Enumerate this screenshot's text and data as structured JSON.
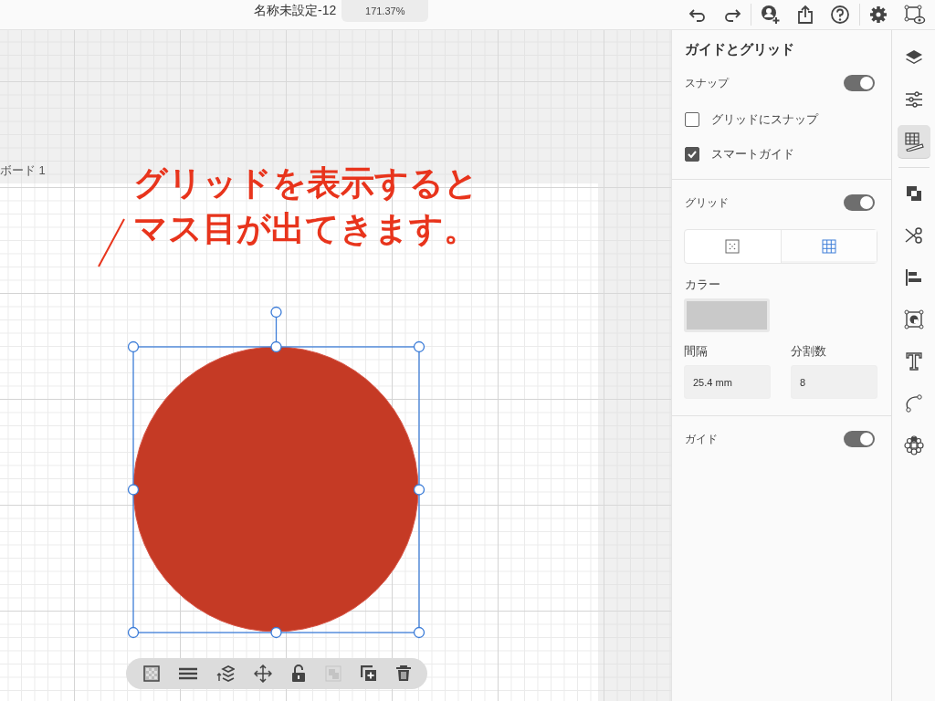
{
  "document": {
    "title": "名称未設定-12",
    "zoom": "171.37%"
  },
  "canvas": {
    "artboard_label": "ボード 1",
    "annotation": [
      "グリッドを表示すると",
      "マス目が出てきます。"
    ],
    "shape": {
      "kind": "circle",
      "selected": true
    }
  },
  "selection_toolbar": [
    {
      "kind": "fill",
      "disabled": false
    },
    {
      "kind": "stroke",
      "disabled": false
    },
    {
      "kind": "arrange",
      "disabled": false
    },
    {
      "kind": "move",
      "disabled": false
    },
    {
      "kind": "lock",
      "disabled": false
    },
    {
      "kind": "group",
      "disabled": true
    },
    {
      "kind": "duplicate",
      "disabled": false
    },
    {
      "kind": "delete",
      "disabled": false
    }
  ],
  "panel": {
    "title": "ガイドとグリッド",
    "snap": {
      "label": "スナップ",
      "on": true,
      "options": [
        {
          "label": "グリッドにスナップ",
          "checked": false
        },
        {
          "label": "スマートガイド",
          "checked": true
        }
      ]
    },
    "grid": {
      "label": "グリッド",
      "on": true,
      "styles": [
        {
          "kind": "dots",
          "selected": false
        },
        {
          "kind": "lines",
          "selected": true
        }
      ],
      "color_label": "カラー",
      "spacing": {
        "label": "間隔",
        "value": "25.4 mm"
      },
      "divisions": {
        "label": "分割数",
        "value": "8"
      }
    },
    "guides": {
      "label": "ガイド",
      "on": true
    }
  },
  "rail": [
    {
      "kind": "layers",
      "selected": false
    },
    {
      "kind": "properties",
      "selected": false
    },
    {
      "kind": "grid",
      "selected": true
    },
    {
      "kind": "boolean",
      "selected": false
    },
    {
      "kind": "cut",
      "selected": false
    },
    {
      "kind": "align",
      "selected": false
    },
    {
      "kind": "mask",
      "selected": false
    },
    {
      "kind": "text",
      "selected": false
    },
    {
      "kind": "path",
      "selected": false
    },
    {
      "kind": "component",
      "selected": false
    }
  ]
}
